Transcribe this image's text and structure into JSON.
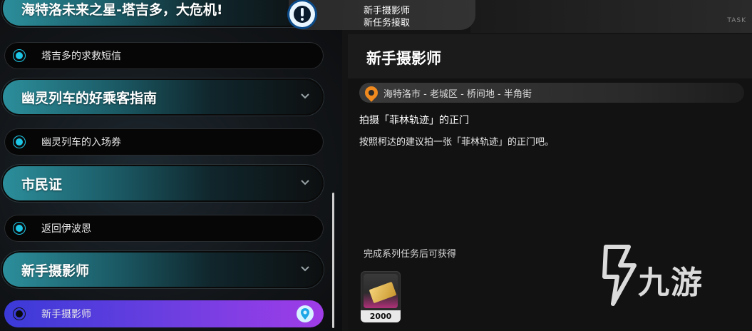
{
  "notice": {
    "title": "新手摄影师",
    "subtitle": "新任务接取"
  },
  "top_right_tag": "TASK",
  "quest_list": {
    "groups": [
      {
        "label": "海特洛未来之星-塔吉多，大危机!",
        "items": [
          {
            "label": "塔吉多的求救短信",
            "active": false
          }
        ]
      },
      {
        "label": "幽灵列车的好乘客指南",
        "items": [
          {
            "label": "幽灵列车的入场券",
            "active": false
          }
        ]
      },
      {
        "label": "市民证",
        "items": [
          {
            "label": "返回伊波恩",
            "active": false
          }
        ]
      },
      {
        "label": "新手摄影师",
        "items": [
          {
            "label": "新手摄影师",
            "active": true
          }
        ]
      }
    ]
  },
  "detail": {
    "title": "新手摄影师",
    "location": "海特洛市 - 老城区 - 桥间地 - 半角街",
    "objective": "拍摄「菲林轨迹」的正门",
    "description": "按照柯达的建议拍一张「菲林轨迹」的正门吧。",
    "reward_label": "完成系列任务后可获得",
    "reward_count": "2000"
  },
  "watermark": {
    "text": "九游"
  },
  "colors": {
    "accent_cyan": "#1ec7e6",
    "active_gradient_start": "#3a3ad8",
    "active_gradient_end": "#a03de8",
    "location_pin": "#f08a1f"
  },
  "icons": {
    "notice": "exclamation-icon",
    "chevron": "chevron-down-icon",
    "nav_pin": "map-pin-icon",
    "location": "location-pin-icon"
  }
}
